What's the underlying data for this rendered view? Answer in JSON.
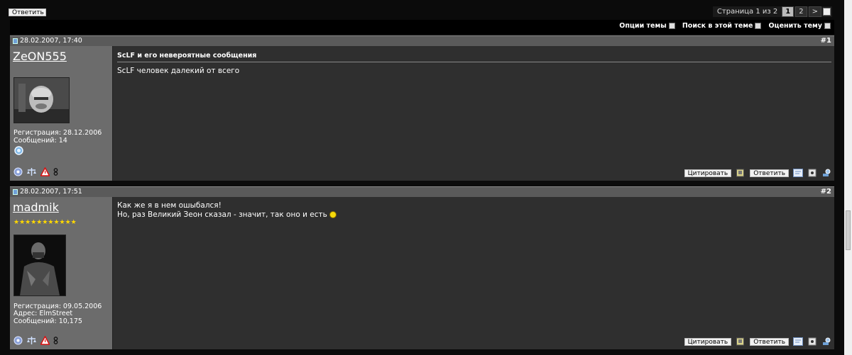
{
  "top": {
    "reply_label": "Ответить",
    "pager": {
      "label": "Страница 1 из 2",
      "pages": [
        "1",
        "2"
      ],
      "next": ">"
    }
  },
  "thread_tools": {
    "options": "Опции темы",
    "search": "Поиск в этой теме",
    "rate": "Оценить тему"
  },
  "posts": [
    {
      "date": "28.02.2007, 17:40",
      "number": "#1",
      "username": "ZeON555",
      "registration": "Регистрация: 28.12.2006",
      "messages": "Сообщений: 14",
      "title": "ScLF и его невероятные сообщения",
      "lines": [
        "ScLF человек далекий от всего"
      ],
      "quote_label": "Цитировать",
      "reply_label": "Ответить"
    },
    {
      "date": "28.02.2007, 17:51",
      "number": "#2",
      "username": "madmik",
      "stars": "★★★★★★★★★★★",
      "registration": "Регистрация: 09.05.2006",
      "address": "Адрес: ElmStreet",
      "messages": "Сообщений: 10,175",
      "lines": [
        "Как же я в нем ошыбался!",
        "Но, раз Великий Зеон сказал - значит, так оно и есть"
      ],
      "quote_label": "Цитировать",
      "reply_label": "Ответить"
    }
  ],
  "colors": {
    "stars": "#ffd800",
    "user_panel": "#6c6c6c",
    "message_bg": "#2f2f2f"
  }
}
